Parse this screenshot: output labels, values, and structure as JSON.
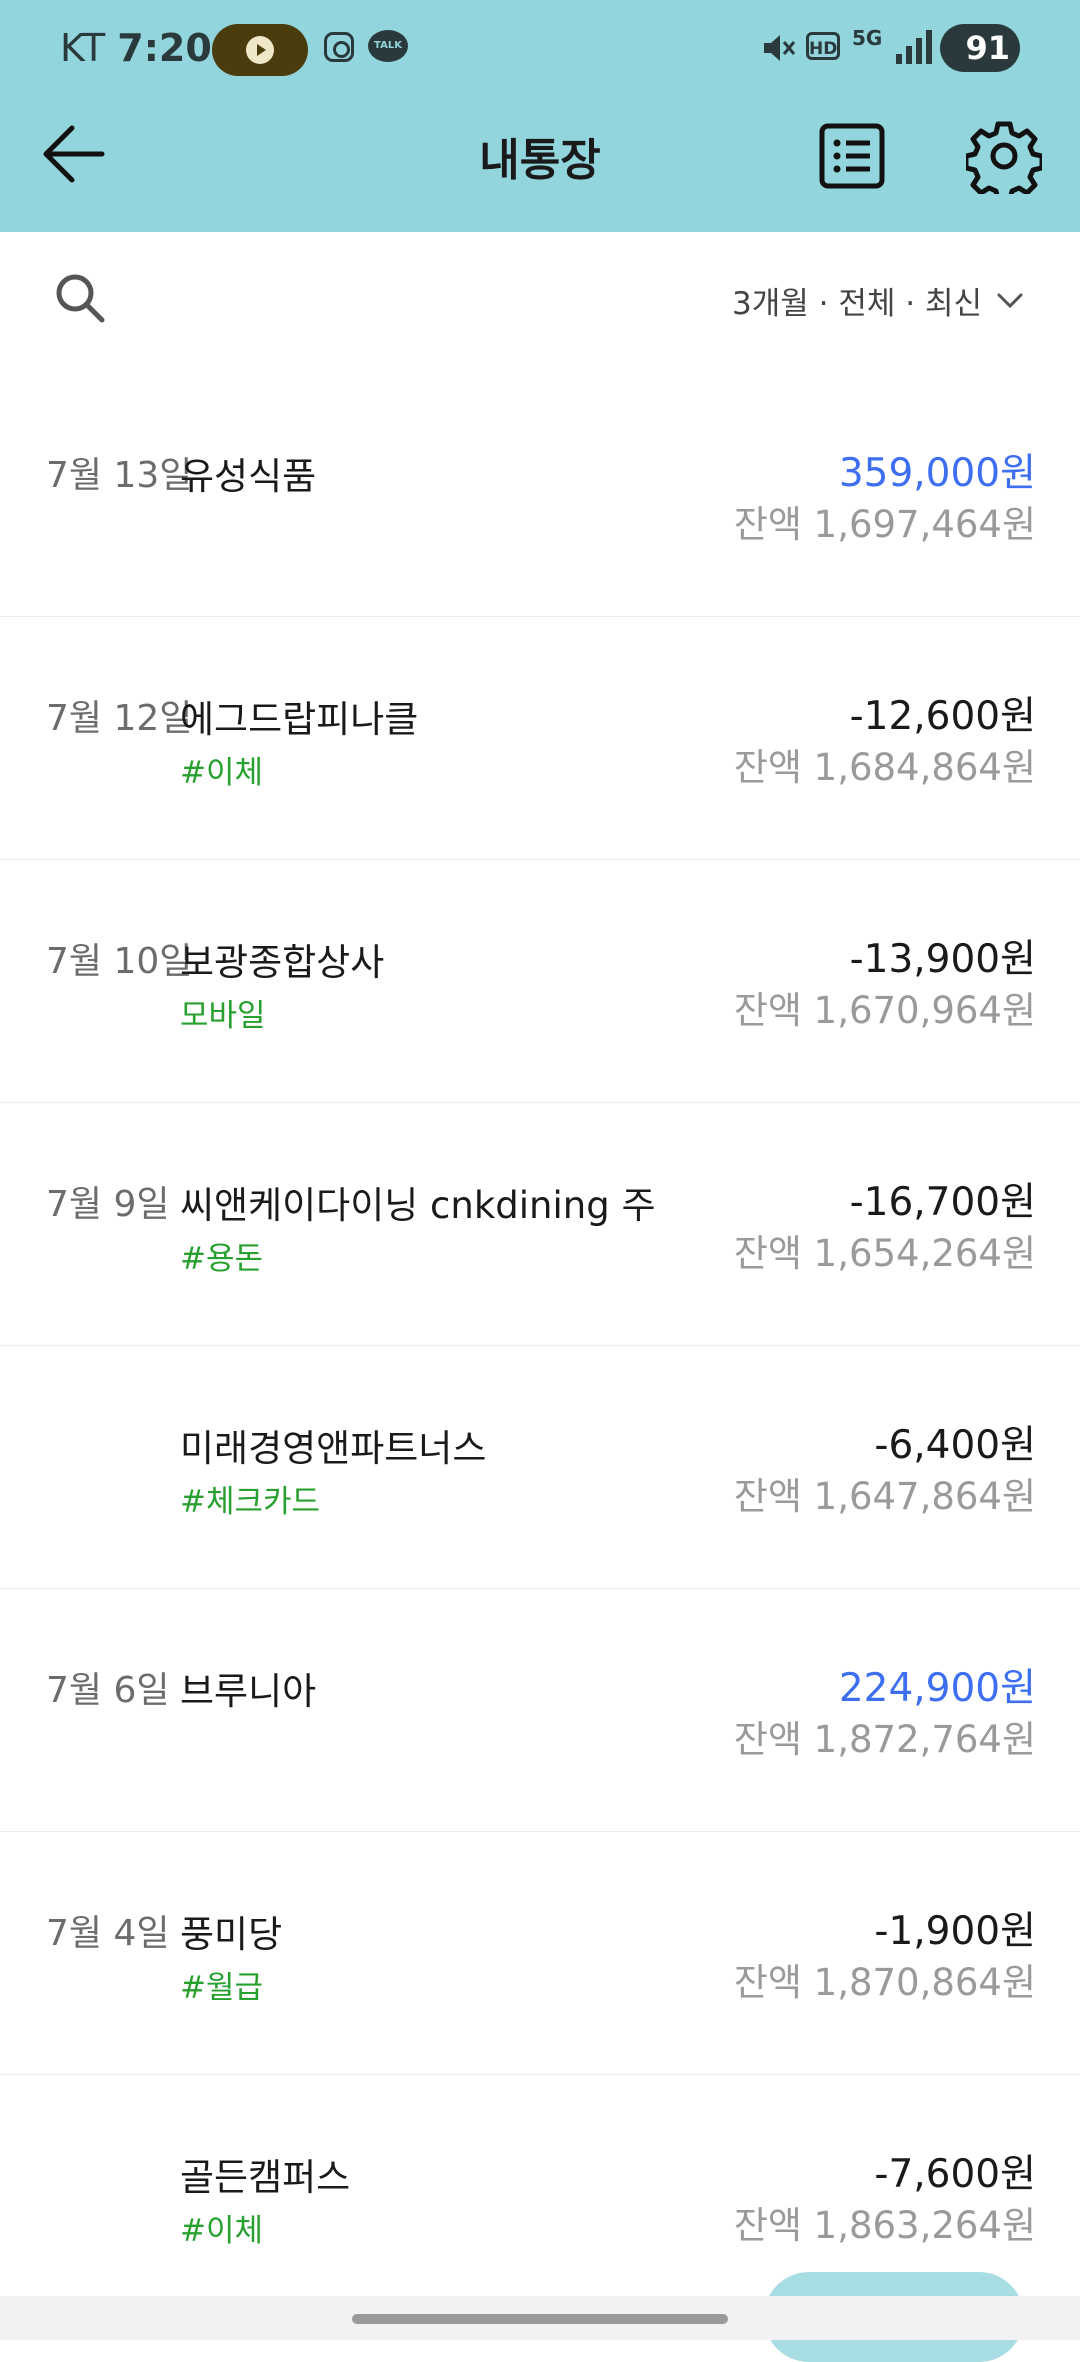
{
  "status_bar": {
    "carrier": "KT",
    "time": "7:20",
    "talk_badge": "TALK",
    "hd": "HD",
    "network": "5G",
    "battery": "91"
  },
  "header": {
    "title": "내통장"
  },
  "filter": {
    "label": "3개월 · 전체 · 최신"
  },
  "transactions": [
    {
      "date": "7월 13일",
      "name": "유성식품",
      "tag": "",
      "amount": "359,000원",
      "balance": "잔액 1,697,464원",
      "direction": "in"
    },
    {
      "date": "7월 12일",
      "name": "에그드랍피나클",
      "tag": "#이체",
      "amount": "-12,600원",
      "balance": "잔액 1,684,864원",
      "direction": "out"
    },
    {
      "date": "7월 10일",
      "name": "보광종합상사",
      "tag": "모바일",
      "amount": "-13,900원",
      "balance": "잔액 1,670,964원",
      "direction": "out"
    },
    {
      "date": "7월 9일",
      "name": "씨앤케이다이닝 cnkdining 주",
      "tag": "#용돈",
      "amount": "-16,700원",
      "balance": "잔액 1,654,264원",
      "direction": "out"
    },
    {
      "date": "",
      "name": "미래경영앤파트너스",
      "tag": "#체크카드",
      "amount": "-6,400원",
      "balance": "잔액 1,647,864원",
      "direction": "out"
    },
    {
      "date": "7월 6일",
      "name": "브루니아",
      "tag": "",
      "amount": "224,900원",
      "balance": "잔액 1,872,764원",
      "direction": "in"
    },
    {
      "date": "7월 4일",
      "name": "풍미당",
      "tag": "#월급",
      "amount": "-1,900원",
      "balance": "잔액 1,870,864원",
      "direction": "out"
    },
    {
      "date": "",
      "name": "골든캠퍼스",
      "tag": "#이체",
      "amount": "-7,600원",
      "balance": "잔액 1,863,264원",
      "direction": "out"
    }
  ],
  "colors": {
    "header_bg": "#92d5dd",
    "income": "#3d6ff0",
    "tag": "#27a02f"
  }
}
